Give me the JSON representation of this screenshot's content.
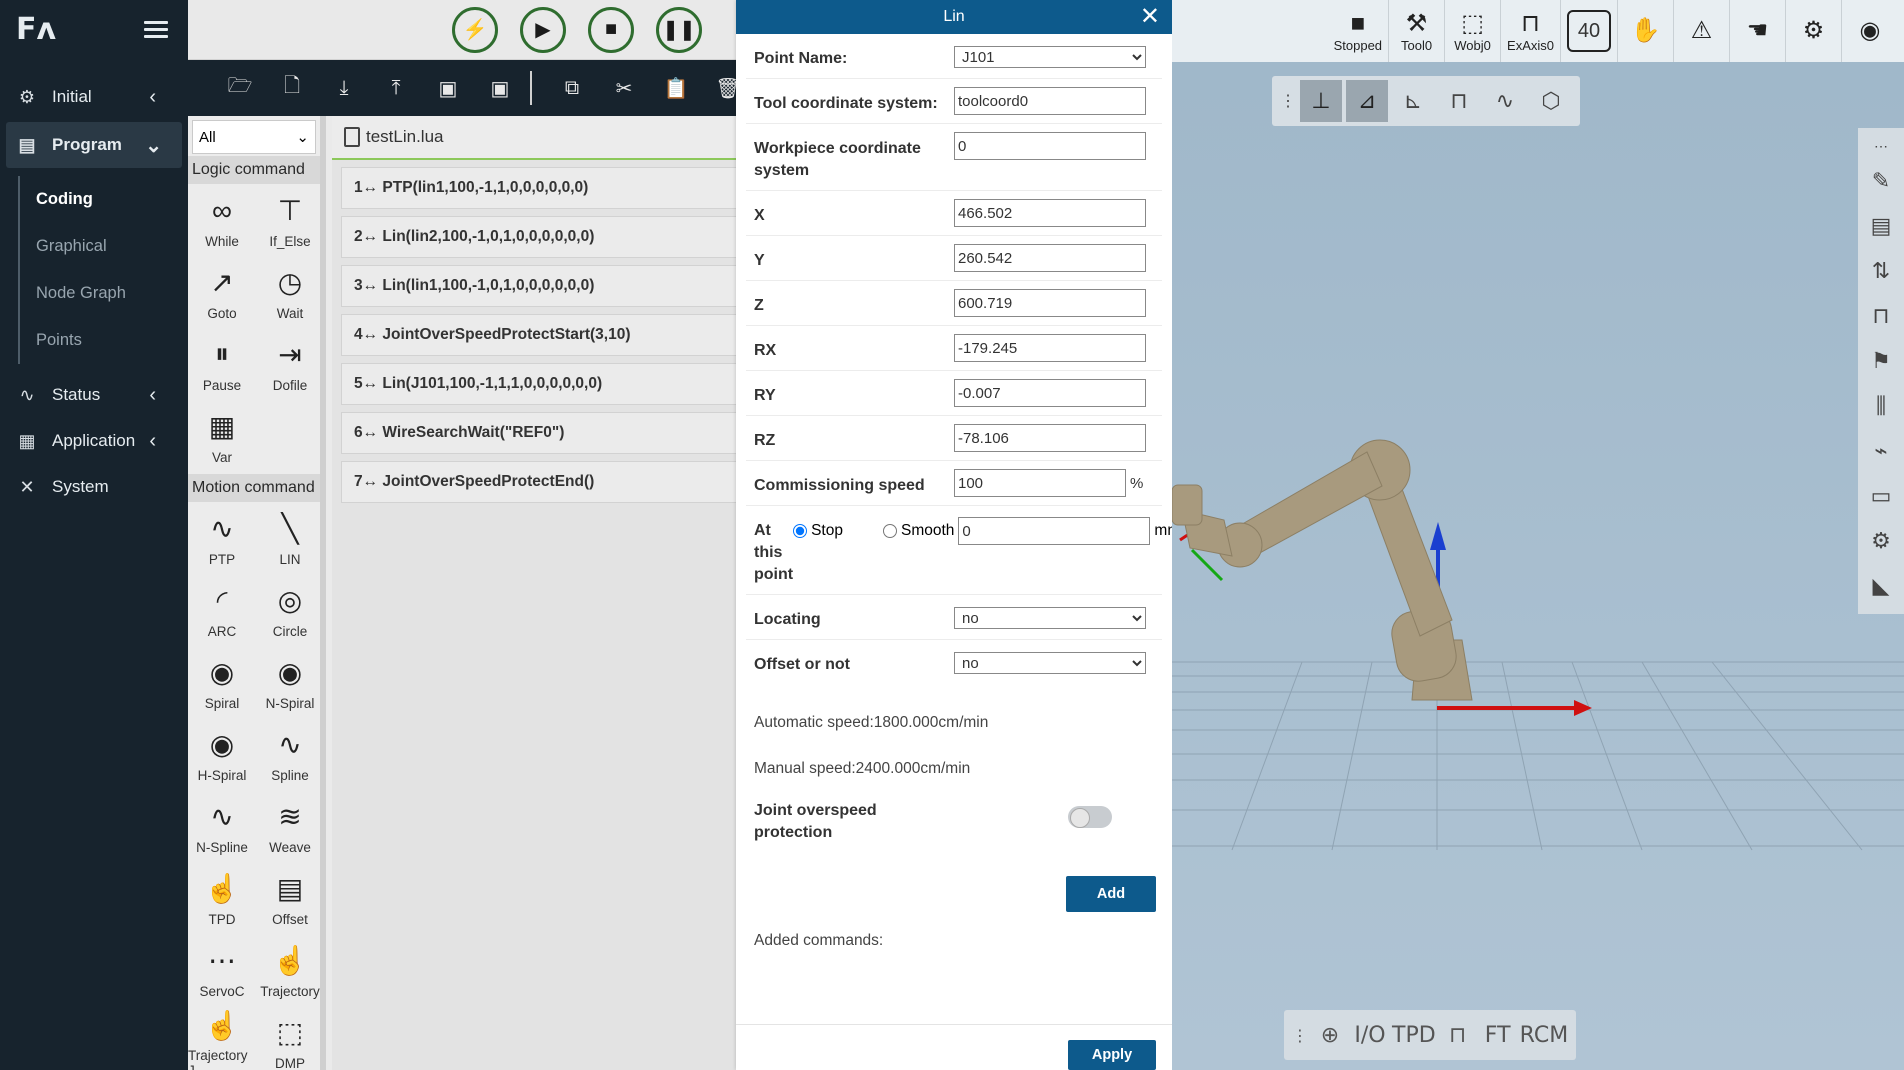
{
  "sidebar": {
    "logo": "Fᴧ",
    "items": [
      {
        "label": "Initial"
      },
      {
        "label": "Program"
      },
      {
        "label": "Status"
      },
      {
        "label": "Application"
      },
      {
        "label": "System"
      }
    ],
    "program_sub": [
      "Coding",
      "Graphical",
      "Node Graph",
      "Points"
    ]
  },
  "palette": {
    "filter": "All",
    "logic_title": "Logic command",
    "logic": [
      {
        "label": "While",
        "icon": "∞"
      },
      {
        "label": "If_Else",
        "icon": "⊤"
      },
      {
        "label": "Goto",
        "icon": "↗"
      },
      {
        "label": "Wait",
        "icon": "◷"
      },
      {
        "label": "Pause",
        "icon": "⏸"
      },
      {
        "label": "Dofile",
        "icon": "⇥"
      },
      {
        "label": "Var",
        "icon": "▦"
      }
    ],
    "motion_title": "Motion command",
    "motion": [
      {
        "label": "PTP",
        "icon": "∿"
      },
      {
        "label": "LIN",
        "icon": "╲"
      },
      {
        "label": "ARC",
        "icon": "◜"
      },
      {
        "label": "Circle",
        "icon": "◎"
      },
      {
        "label": "Spiral",
        "icon": "◉"
      },
      {
        "label": "N-Spiral",
        "icon": "◉"
      },
      {
        "label": "H-Spiral",
        "icon": "◉"
      },
      {
        "label": "Spline",
        "icon": "∿"
      },
      {
        "label": "N-Spline",
        "icon": "∿"
      },
      {
        "label": "Weave",
        "icon": "≋"
      },
      {
        "label": "TPD",
        "icon": "☝"
      },
      {
        "label": "Offset",
        "icon": "▤"
      },
      {
        "label": "ServoC",
        "icon": "⋯"
      },
      {
        "label": "Trajectory",
        "icon": "☝"
      },
      {
        "label": "Trajectory J",
        "icon": "☝"
      },
      {
        "label": "DMP",
        "icon": "⬚"
      }
    ]
  },
  "editor": {
    "file": "testLin.lua",
    "lines": [
      "1↔ PTP(lin1,100,-1,1,0,0,0,0,0,0)",
      "2↔ Lin(lin2,100,-1,0,1,0,0,0,0,0,0)",
      "3↔ Lin(lin1,100,-1,0,1,0,0,0,0,0,0)",
      "4↔ JointOverSpeedProtectStart(3,10)",
      "5↔ Lin(J101,100,-1,1,1,0,0,0,0,0,0)",
      "6↔ WireSearchWait(\"REF0\")",
      "7↔ JointOverSpeedProtectEnd()"
    ]
  },
  "dialog": {
    "title": "Lin",
    "point_name_label": "Point Name:",
    "point_name_value": "J101",
    "tool_label": "Tool coordinate system:",
    "tool_value": "toolcoord0",
    "workpiece_label": "Workpiece coordinate system",
    "workpiece_value": "0",
    "x_label": "X",
    "x_value": "466.502",
    "y_label": "Y",
    "y_value": "260.542",
    "z_label": "Z",
    "z_value": "600.719",
    "rx_label": "RX",
    "rx_value": "-179.245",
    "ry_label": "RY",
    "ry_value": "-0.007",
    "rz_label": "RZ",
    "rz_value": "-78.106",
    "speed_label": "Commissioning speed",
    "speed_value": "100",
    "speed_unit": "%",
    "point_label": "At this point",
    "stop_label": "Stop",
    "smooth_label": "Smooth",
    "smooth_value": "0",
    "smooth_unit": "mm",
    "locating_label": "Locating",
    "locating_value": "no",
    "offset_label": "Offset or not",
    "offset_value": "no",
    "auto_speed": "Automatic speed:1800.000cm/min",
    "manual_speed": "Manual speed:2400.000cm/min",
    "joint_label": "Joint overspeed protection",
    "add_label": "Add",
    "added_label": "Added commands:",
    "apply_label": "Apply"
  },
  "status": {
    "state": "Stopped",
    "tool": "Tool0",
    "wobj": "Wobj0",
    "exaxis": "ExAxis0",
    "speed": "40"
  },
  "bottom_tools": [
    "⊕",
    "I/O",
    "TPD",
    "⊓",
    "FT",
    "RCM"
  ]
}
